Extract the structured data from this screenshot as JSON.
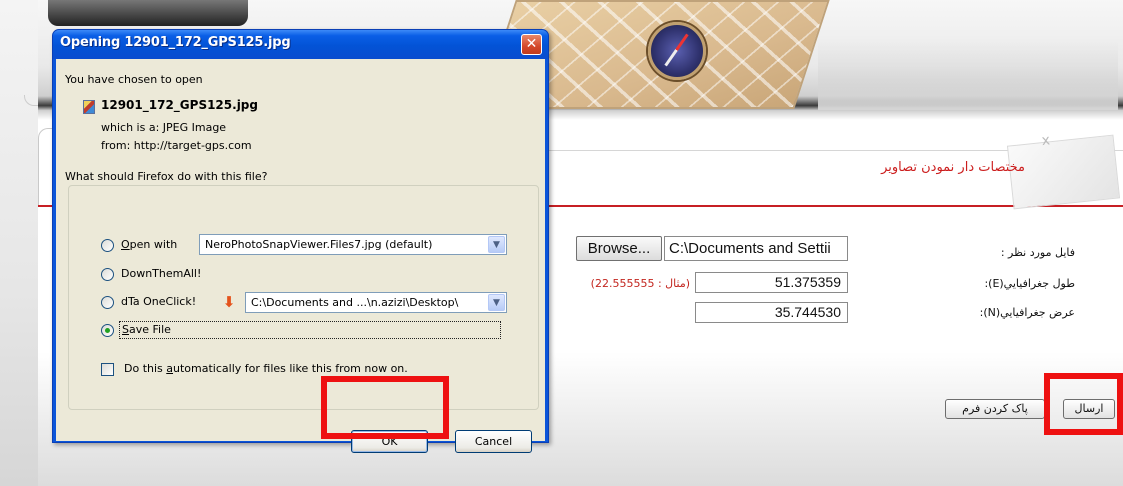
{
  "dialog": {
    "title": "Opening 12901_172_GPS125.jpg",
    "close_glyph": "✕",
    "chosen_text": "You have chosen to open",
    "filename": "12901_172_GPS125.jpg",
    "which_is": "which is a:  JPEG Image",
    "from": "from:  http://target-gps.com",
    "question": "What should Firefox do with this file?",
    "options": {
      "open_with": {
        "label_underlined": "O",
        "label_rest": "pen with",
        "checked": false,
        "app": "NeroPhotoSnapViewer.Files7.jpg (default)"
      },
      "downthemall": {
        "label": "DownThemAll!",
        "checked": false
      },
      "dta_oneclick": {
        "label": "dTa OneClick!",
        "checked": false,
        "path": "C:\\Documents and ...\\n.azizi\\Desktop\\"
      },
      "save_file": {
        "label_underlined": "S",
        "label_rest": "ave File",
        "checked": true
      }
    },
    "auto_checkbox": {
      "label_before": "Do this ",
      "label_underlined": "a",
      "label_after": "utomatically for files like this from now on.",
      "checked": false
    },
    "ok_label": "OK",
    "cancel_label": "Cancel",
    "dropdown_glyph": "▼"
  },
  "page": {
    "section_title": "مختصات دار نمودن تصاوير",
    "form": {
      "file_label": "فايل مورد نظر :",
      "browse_label": "Browse...",
      "file_value": "C:\\Documents and Settii",
      "longitude_label": "طول جغرافيايي(E):",
      "longitude_value": "51.375359",
      "longitude_example": "(مثال : 22.555555)",
      "latitude_label": "عرض جغرافيايي(N):",
      "latitude_value": "35.744530"
    },
    "reset_label": "پاک کردن فرم",
    "submit_label": "ارسال"
  },
  "colors": {
    "highlight": "#ee1111",
    "title_red": "#cc1e1e",
    "xp_blue": "#0b55d9",
    "dialog_face": "#ece9d8"
  },
  "icons": {
    "file": "jpeg-file-icon",
    "dta": "download-arrow-icon",
    "compass": "compass-icon"
  }
}
